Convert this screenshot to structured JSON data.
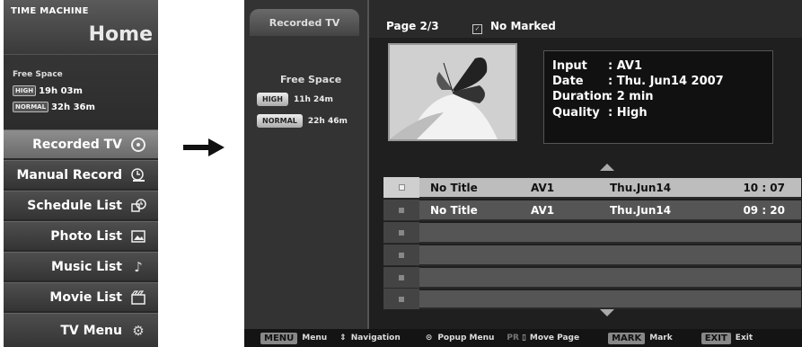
{
  "time_machine": {
    "title": "TIME MACHINE",
    "home": "Home",
    "free_space_label": "Free Space",
    "quality": [
      {
        "badge": "HIGH",
        "time": "19h 03m"
      },
      {
        "badge": "NORMAL",
        "time": "32h 36m"
      }
    ],
    "menu": [
      {
        "label": "Recorded TV",
        "icon": "film-reel-icon"
      },
      {
        "label": "Manual Record",
        "icon": "record-clock-icon"
      },
      {
        "label": "Schedule List",
        "icon": "schedule-clock-icon"
      },
      {
        "label": "Photo List",
        "icon": "photo-icon"
      },
      {
        "label": "Music List",
        "icon": "music-note-icon"
      },
      {
        "label": "Movie List",
        "icon": "movie-icon"
      },
      {
        "label": "TV Menu",
        "icon": "gears-icon"
      }
    ]
  },
  "recorded_tv": {
    "tab": "Recorded TV",
    "free_space_label": "Free Space",
    "quality": [
      {
        "badge": "HIGH",
        "time": "11h 24m"
      },
      {
        "badge": "NORMAL",
        "time": "22h 46m"
      }
    ],
    "page": "Page 2/3",
    "marked": "No Marked",
    "info": {
      "input_label": "Input",
      "input_value": ": AV1",
      "date_label": "Date",
      "date_value": ": Thu. Jun14 2007",
      "duration_label": "Duration",
      "duration_value": ": 2 min",
      "quality_label": "Quality",
      "quality_value": ": High"
    },
    "rows": [
      {
        "title": "No Title",
        "input": "AV1",
        "date": "Thu.Jun14",
        "time": "10 : 07"
      },
      {
        "title": "No Title",
        "input": "AV1",
        "date": "Thu.Jun14",
        "time": "09 : 20"
      }
    ],
    "bottom_bar": {
      "menu_key": "MENU",
      "menu_label": "Menu",
      "nav_label": "Navigation",
      "popup_label": "Popup Menu",
      "pr_key": "PR",
      "move_label": "Move Page",
      "mark_key": "MARK",
      "mark_label": "Mark",
      "exit_key": "EXIT",
      "exit_label": "Exit"
    }
  }
}
